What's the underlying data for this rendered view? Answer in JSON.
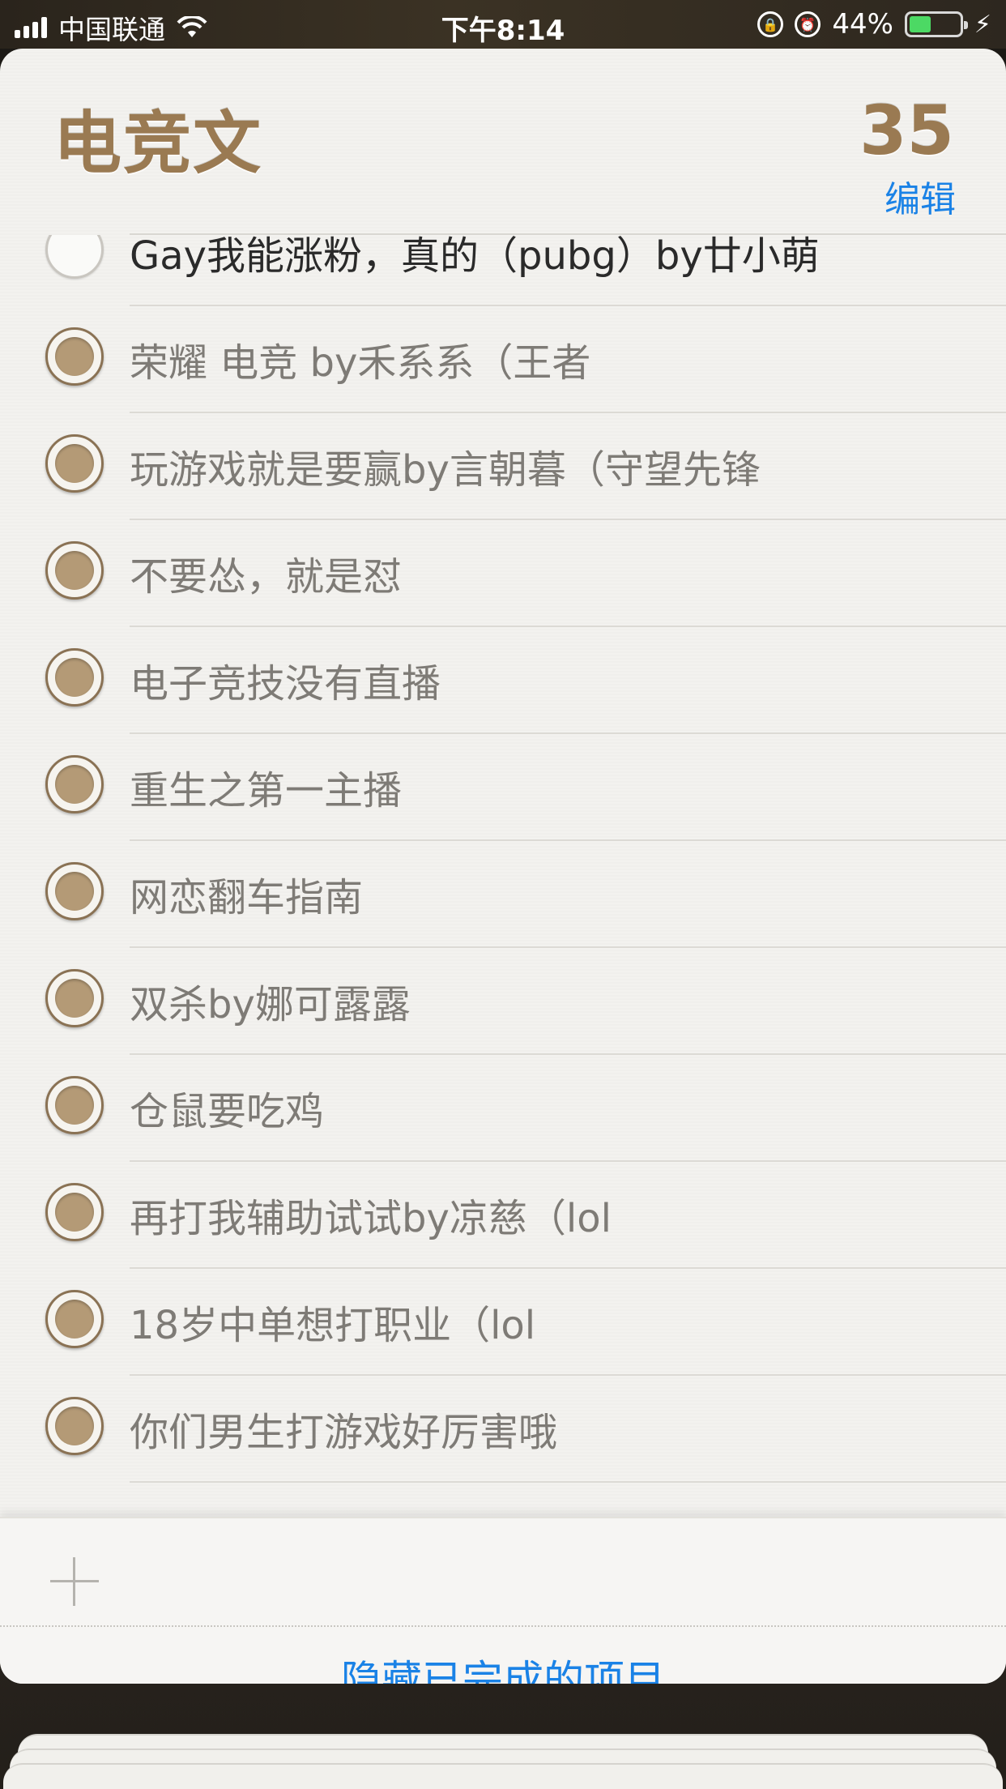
{
  "status_bar": {
    "carrier": "中国联通",
    "time": "下午8:14",
    "battery_percent": "44%",
    "battery_level": 0.44,
    "icons": [
      "signal-icon",
      "wifi-icon",
      "rotation-lock-icon",
      "alarm-icon",
      "battery-icon",
      "charging-bolt-icon"
    ]
  },
  "list": {
    "title": "电竞文",
    "count": "35",
    "edit_label": "编辑",
    "items": [
      {
        "text": "Gay我能涨粉，真的（pubg）by廿小萌",
        "completed": false
      },
      {
        "text": "荣耀 电竞 by禾系系（王者",
        "completed": true
      },
      {
        "text": "玩游戏就是要赢by言朝暮（守望先锋",
        "completed": true
      },
      {
        "text": "不要怂，就是怼",
        "completed": true
      },
      {
        "text": "电子竞技没有直播",
        "completed": true
      },
      {
        "text": "重生之第一主播",
        "completed": true
      },
      {
        "text": "网恋翻车指南",
        "completed": true
      },
      {
        "text": "双杀by娜可露露",
        "completed": true
      },
      {
        "text": "仓鼠要吃鸡",
        "completed": true
      },
      {
        "text": "再打我辅助试试by凉慈（lol",
        "completed": true
      },
      {
        "text": "18岁中单想打职业（lol",
        "completed": true
      },
      {
        "text": "你们男生打游戏好厉害哦",
        "completed": true
      }
    ]
  },
  "footer": {
    "hide_completed_label": "隐藏已完成的项目"
  },
  "colors": {
    "accent_blue": "#1a82e6",
    "title_gold": "#9a7a52",
    "completed_fill": "#b49a76"
  }
}
